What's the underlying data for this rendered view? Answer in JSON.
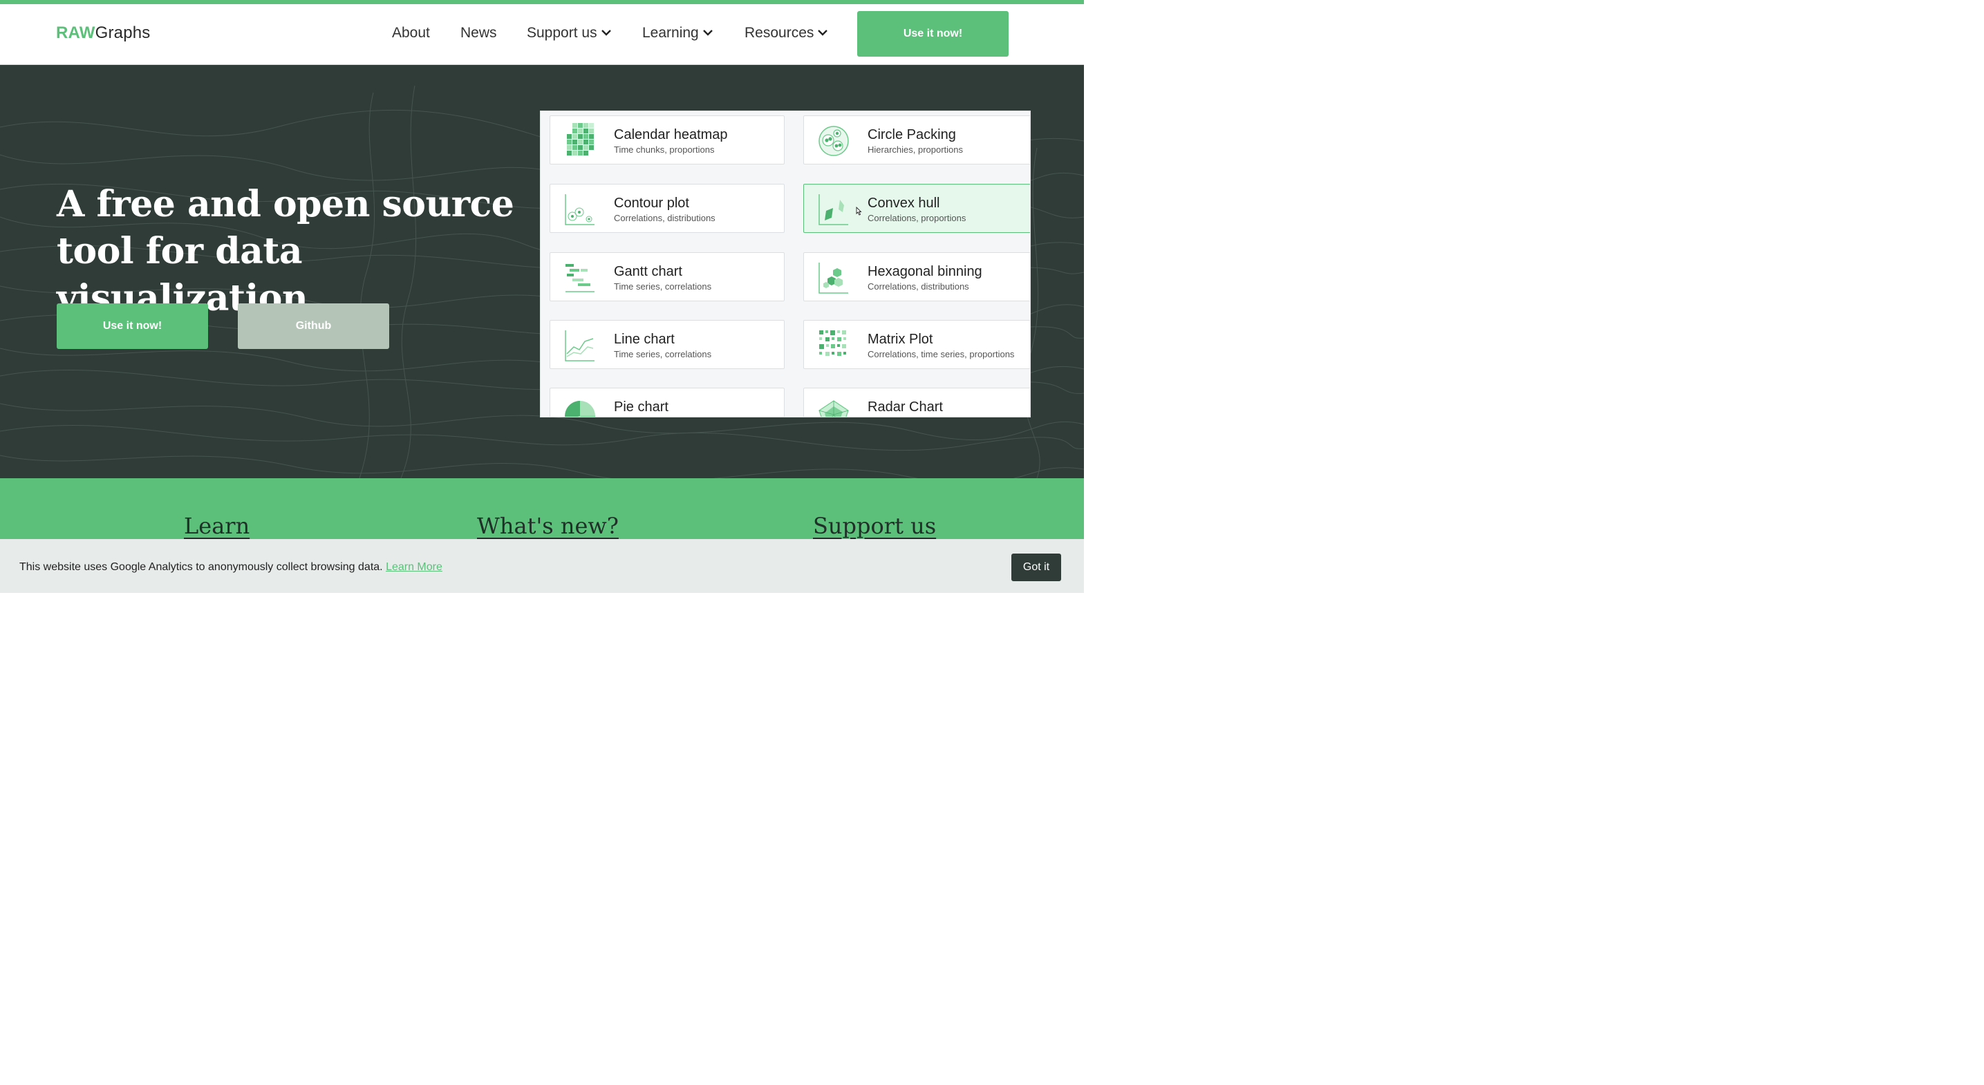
{
  "header": {
    "logo_primary": "RAW",
    "logo_secondary": "Graphs",
    "nav": [
      {
        "label": "About"
      },
      {
        "label": "News"
      },
      {
        "label": "Support us"
      },
      {
        "label": "Learning"
      },
      {
        "label": "Resources"
      }
    ],
    "cta_label": "Use it now!"
  },
  "hero": {
    "title_line1": "A free and open source",
    "title_line2": "tool for data visualization",
    "primary_button": "Use it now!",
    "secondary_button": "Github"
  },
  "charts": [
    {
      "title": "Calendar heatmap",
      "subtitle": "Time chunks, proportions",
      "icon": "calendar-heatmap-icon"
    },
    {
      "title": "Circle Packing",
      "subtitle": "Hierarchies, proportions",
      "icon": "circle-packing-icon"
    },
    {
      "title": "Contour plot",
      "subtitle": "Correlations, distributions",
      "icon": "contour-plot-icon"
    },
    {
      "title": "Convex hull",
      "subtitle": "Correlations, proportions",
      "icon": "convex-hull-icon"
    },
    {
      "title": "Gantt chart",
      "subtitle": "Time series, correlations",
      "icon": "gantt-chart-icon"
    },
    {
      "title": "Hexagonal binning",
      "subtitle": "Correlations, distributions",
      "icon": "hexagonal-binning-icon"
    },
    {
      "title": "Line chart",
      "subtitle": "Time series, correlations",
      "icon": "line-chart-icon"
    },
    {
      "title": "Matrix Plot",
      "subtitle": "Correlations, time series, proportions",
      "icon": "matrix-plot-icon"
    },
    {
      "title": "Pie chart",
      "subtitle": "",
      "icon": "pie-chart-icon"
    },
    {
      "title": "Radar Chart",
      "subtitle": "",
      "icon": "radar-chart-icon"
    }
  ],
  "band": {
    "learn": "Learn",
    "whats_new": "What's new?",
    "support": "Support us"
  },
  "cookie": {
    "text": "This website uses Google Analytics to anonymously collect browsing data.",
    "link": "Learn More",
    "button": "Got it"
  },
  "colors": {
    "brand_green": "#5cbf7a",
    "hero_bg": "#2f3c38",
    "secondary_button": "#b4c4b7"
  }
}
